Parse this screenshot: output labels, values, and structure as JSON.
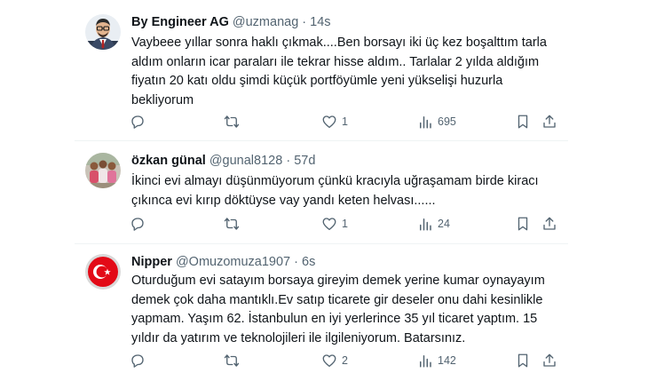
{
  "tweets": [
    {
      "name": "By Engineer AG",
      "handle": "@uzmanag",
      "dot": "·",
      "time": "14s",
      "text": "Vaybeee yıllar sonra haklı çıkmak....Ben borsayı iki üç kez boşalttım tarla aldım onların icar paraları ile tekrar hisse aldım.. Tarlalar 2 yılda aldığım fiyatın 20 katı oldu şimdi küçük portföyümle yeni yükselişi huzurla bekliyorum",
      "likes": "1",
      "views": "695"
    },
    {
      "name": "özkan günal",
      "handle": "@gunal8128",
      "dot": "·",
      "time": "57d",
      "text": "İkinci evi almayı düşünmüyorum çünkü kracıyla uğraşamam birde kiracı çıkınca evi kırıp döktüyse vay yandı keten helvası......",
      "likes": "1",
      "views": "24"
    },
    {
      "name": "Nipper",
      "handle": "@Omuzomuza1907",
      "dot": "·",
      "time": "6s",
      "text": "Oturduğum evi satayım borsaya gireyim demek yerine kumar oynayayım demek çok daha mantıklı.Ev satıp ticarete gir deseler onu dahi kesinlikle yapmam. Yaşım 62. İstanbulun en iyi yerlerince 35 yıl ticaret yaptım. 15 yıldır da yatırım ve teknolojileri ile ilgileniyorum. Batarsınız.",
      "likes": "2",
      "views": "142"
    }
  ],
  "icons": [
    "reply-icon",
    "retweet-icon",
    "like-icon",
    "views-icon",
    "bookmark-icon",
    "share-icon"
  ],
  "colors": {
    "text": "#0f1419",
    "secondary": "#536471",
    "divider": "#eff3f4",
    "flag_red": "#e30a17"
  }
}
